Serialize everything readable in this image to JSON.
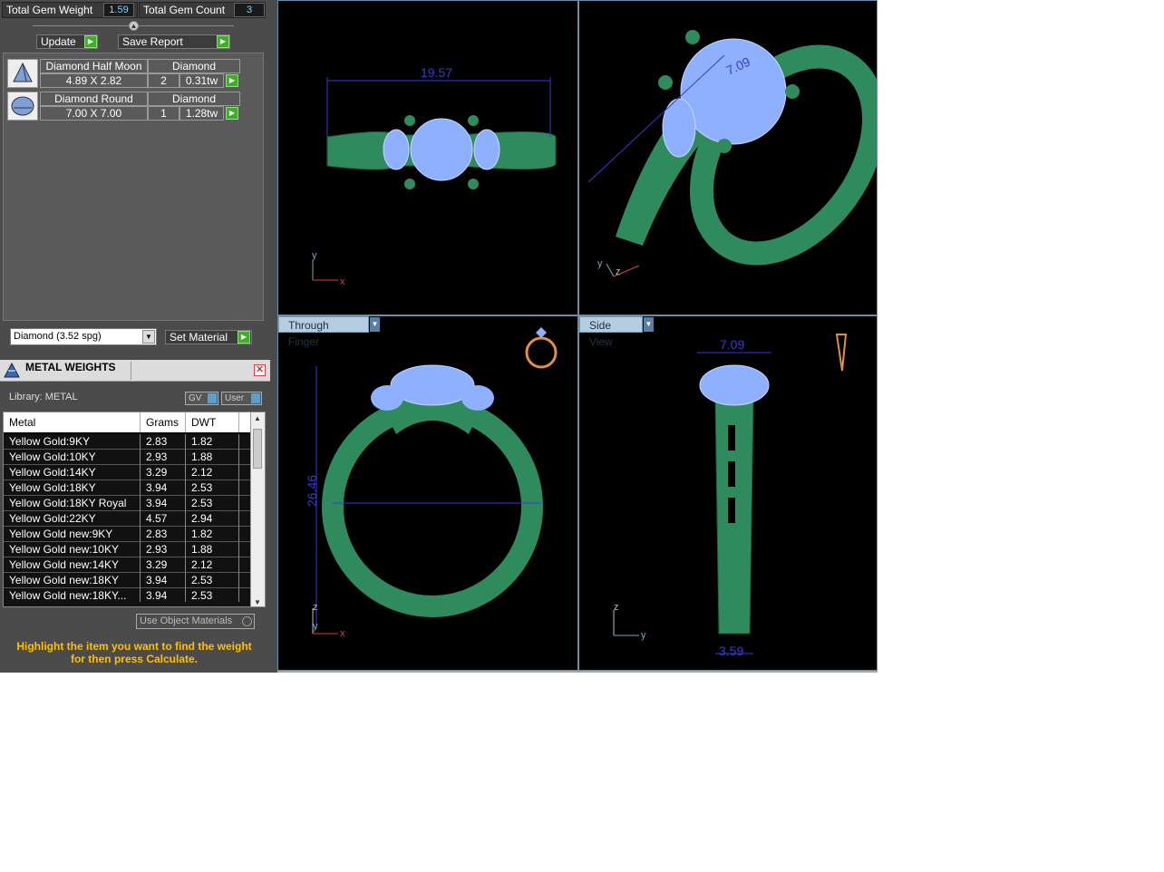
{
  "gem_totals": {
    "weight_label": "Total Gem Weight",
    "weight_value": "1.59",
    "count_label": "Total Gem Count",
    "count_value": "3"
  },
  "actions": {
    "update": "Update",
    "save_report": "Save Report"
  },
  "gems": [
    {
      "name": "Diamond Half Moon",
      "material": "Diamond",
      "size": "4.89 X 2.82",
      "count": "2",
      "weight": "0.31tw"
    },
    {
      "name": "Diamond Round",
      "material": "Diamond",
      "size": "7.00 X 7.00",
      "count": "1",
      "weight": "1.28tw"
    }
  ],
  "material_select": {
    "value": "Diamond     (3.52 spg)",
    "set_label": "Set Material"
  },
  "metal_weights": {
    "title": "METAL WEIGHTS",
    "library": "Library: METAL",
    "gv": "GV",
    "user": "User",
    "columns": [
      "Metal",
      "Grams",
      "DWT"
    ],
    "rows": [
      [
        "Yellow Gold:9KY",
        "2.83",
        "1.82"
      ],
      [
        "Yellow Gold:10KY",
        "2.93",
        "1.88"
      ],
      [
        "Yellow Gold:14KY",
        "3.29",
        "2.12"
      ],
      [
        "Yellow Gold:18KY",
        "3.94",
        "2.53"
      ],
      [
        "Yellow Gold:18KY Royal",
        "3.94",
        "2.53"
      ],
      [
        "Yellow Gold:22KY",
        "4.57",
        "2.94"
      ],
      [
        "Yellow Gold new:9KY",
        "2.83",
        "1.82"
      ],
      [
        "Yellow Gold new:10KY",
        "2.93",
        "1.88"
      ],
      [
        "Yellow Gold new:14KY",
        "3.29",
        "2.12"
      ],
      [
        "Yellow Gold new:18KY",
        "3.94",
        "2.53"
      ],
      [
        "Yellow Gold new:18KY...",
        "3.94",
        "2.53"
      ]
    ],
    "use_object_materials": "Use Object Materials",
    "hint": "Highlight the item you want to find the weight for then press Calculate."
  },
  "viewports": {
    "top": {
      "dim": "19.57",
      "axis_v": "y",
      "axis_h": "x"
    },
    "persp": {
      "dim": "7.09",
      "axis_y": "y",
      "axis_z": "z"
    },
    "front": {
      "label": "Through Finger",
      "dim_h": "26.46",
      "axis_v": "z",
      "axis_v2": "y",
      "axis_h": "x"
    },
    "side": {
      "label": "Side View",
      "dim_top": "7.09",
      "dim_bottom": "3.59",
      "axis_v": "z",
      "axis_h": "y"
    }
  },
  "colors": {
    "metal": "#2f8a5e",
    "gem": "#8fb0ff",
    "dim": "#3a3acc",
    "accent": "#3fae2a"
  }
}
